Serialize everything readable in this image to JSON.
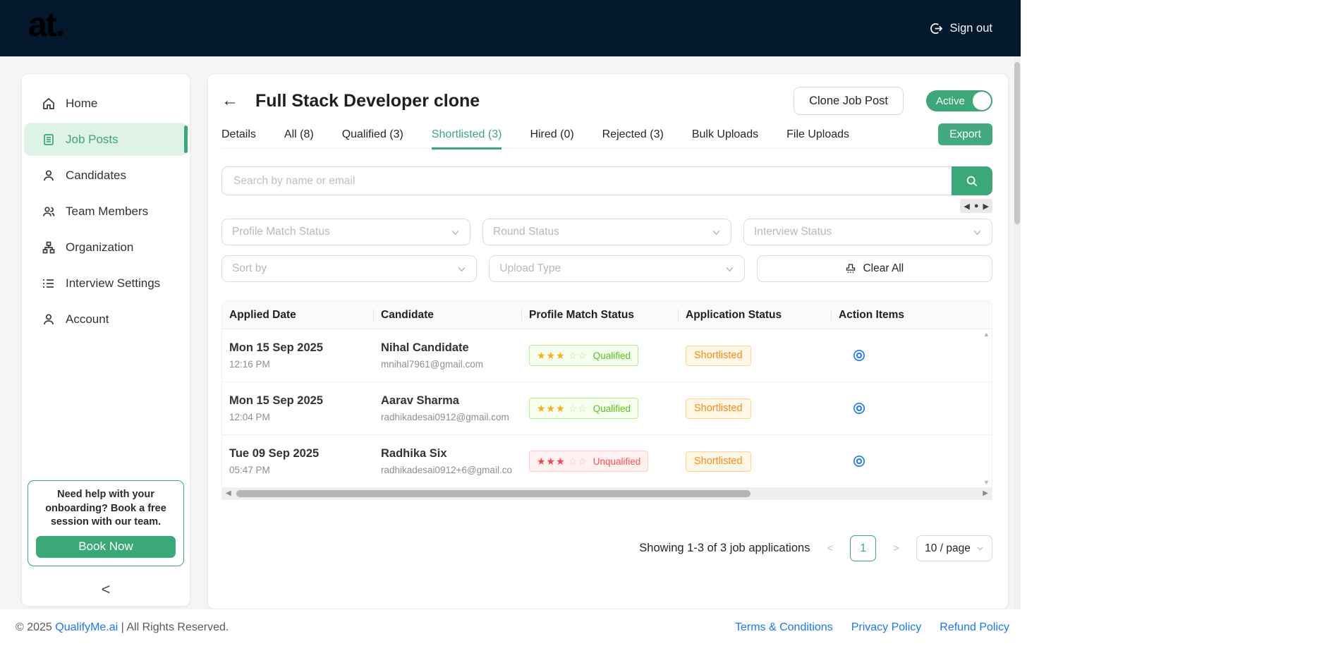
{
  "header": {
    "logo": "at.",
    "sign_out": "Sign out"
  },
  "sidebar": {
    "items": [
      {
        "label": "Home"
      },
      {
        "label": "Job Posts",
        "active": true
      },
      {
        "label": "Candidates"
      },
      {
        "label": "Team Members"
      },
      {
        "label": "Organization"
      },
      {
        "label": "Interview Settings"
      },
      {
        "label": "Account"
      }
    ],
    "help": {
      "text": "Need help with your onboarding? Book a free session with our team.",
      "button": "Book Now"
    },
    "collapse": "<"
  },
  "main": {
    "title": "Full Stack Developer clone",
    "clone_button": "Clone Job Post",
    "status_toggle": "Active",
    "tabs": [
      {
        "label": "Details"
      },
      {
        "label": "All (8)"
      },
      {
        "label": "Qualified (3)"
      },
      {
        "label": "Shortlisted (3)",
        "active": true
      },
      {
        "label": "Hired (0)"
      },
      {
        "label": "Rejected (3)"
      },
      {
        "label": "Bulk Uploads"
      },
      {
        "label": "File Uploads"
      }
    ],
    "export_button": "Export",
    "search": {
      "placeholder": "Search by name or email"
    },
    "filters": {
      "row1": [
        "Profile Match Status",
        "Round Status",
        "Interview Status"
      ],
      "row2": [
        "Sort by",
        "Upload Type"
      ],
      "clear_all": "Clear All"
    },
    "table": {
      "columns": [
        "Applied Date",
        "Candidate",
        "Profile Match Status",
        "Application Status",
        "Action Items"
      ],
      "rows": [
        {
          "date": "Mon 15 Sep 2025",
          "time": "12:16 PM",
          "name": "Nihal Candidate",
          "email": "mnihal7961@gmail.com",
          "match": {
            "label": "Qualified",
            "stars": 3,
            "total": 5,
            "type": "success"
          },
          "status": "Shortlisted"
        },
        {
          "date": "Mon 15 Sep 2025",
          "time": "12:04 PM",
          "name": "Aarav Sharma",
          "email": "radhikadesai0912@gmail.com",
          "match": {
            "label": "Qualified",
            "stars": 3,
            "total": 5,
            "type": "success"
          },
          "status": "Shortlisted"
        },
        {
          "date": "Tue 09 Sep 2025",
          "time": "05:47 PM",
          "name": "Radhika Six",
          "email": "radhikadesai0912+6@gmail.co",
          "match": {
            "label": "Unqualified",
            "stars": 3,
            "total": 5,
            "type": "error"
          },
          "status": "Shortlisted"
        }
      ]
    },
    "pagination": {
      "summary": "Showing 1-3 of 3 job applications",
      "prev": "<",
      "page": "1",
      "next": ">",
      "page_size": "10 / page"
    }
  },
  "footer": {
    "copyright_prefix": "© 2025",
    "brand": "QualifyMe.ai",
    "copyright_suffix": "| All Rights Reserved.",
    "links": [
      "Terms & Conditions",
      "Privacy Policy",
      "Refund Policy"
    ]
  },
  "colors": {
    "accent_green": "#3aa878",
    "header_navy": "#03182c",
    "link_blue": "#1677ff",
    "badge_success_text": "#52c41a",
    "badge_error_text": "#ff4d4f",
    "badge_warning_text": "#fa8c16",
    "star_orange": "#faad14"
  }
}
